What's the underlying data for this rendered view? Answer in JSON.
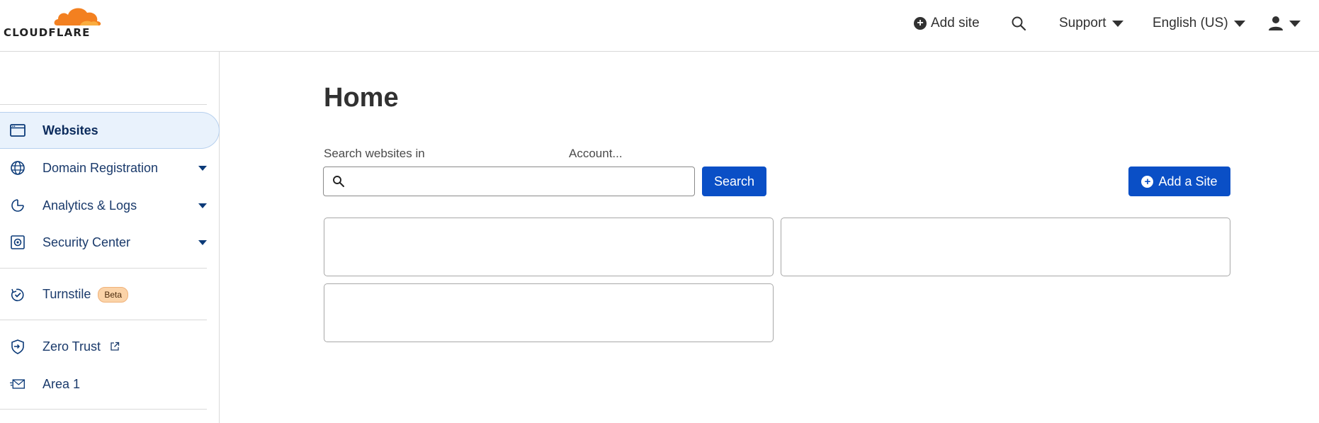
{
  "header": {
    "logo_text": "CLOUDFLARE",
    "add_site_label": "Add site",
    "support_label": "Support",
    "language_label": "English (US)"
  },
  "sidebar": {
    "items": [
      {
        "label": "Websites",
        "icon": "browser-window-icon",
        "active": true
      },
      {
        "label": "Domain Registration",
        "icon": "globe-icon",
        "has_dropdown": true
      },
      {
        "label": "Analytics & Logs",
        "icon": "pie-chart-icon",
        "has_dropdown": true
      },
      {
        "label": "Security Center",
        "icon": "security-center-icon",
        "has_dropdown": true
      },
      {
        "label": "Turnstile",
        "icon": "turnstile-icon",
        "badge": "Beta"
      },
      {
        "label": "Zero Trust",
        "icon": "zero-trust-icon",
        "external": true
      },
      {
        "label": "Area 1",
        "icon": "email-icon"
      }
    ]
  },
  "main": {
    "title": "Home",
    "search_label_prefix": "Search websites in",
    "search_label_account": "Account...",
    "search_input_value": "",
    "search_button": "Search",
    "add_site_button": "Add a Site"
  },
  "colors": {
    "primary": "#0a4fc6",
    "logo_orange": "#f38020",
    "active_bg": "#e9f2fc",
    "nav_text": "#1a3a6b"
  }
}
